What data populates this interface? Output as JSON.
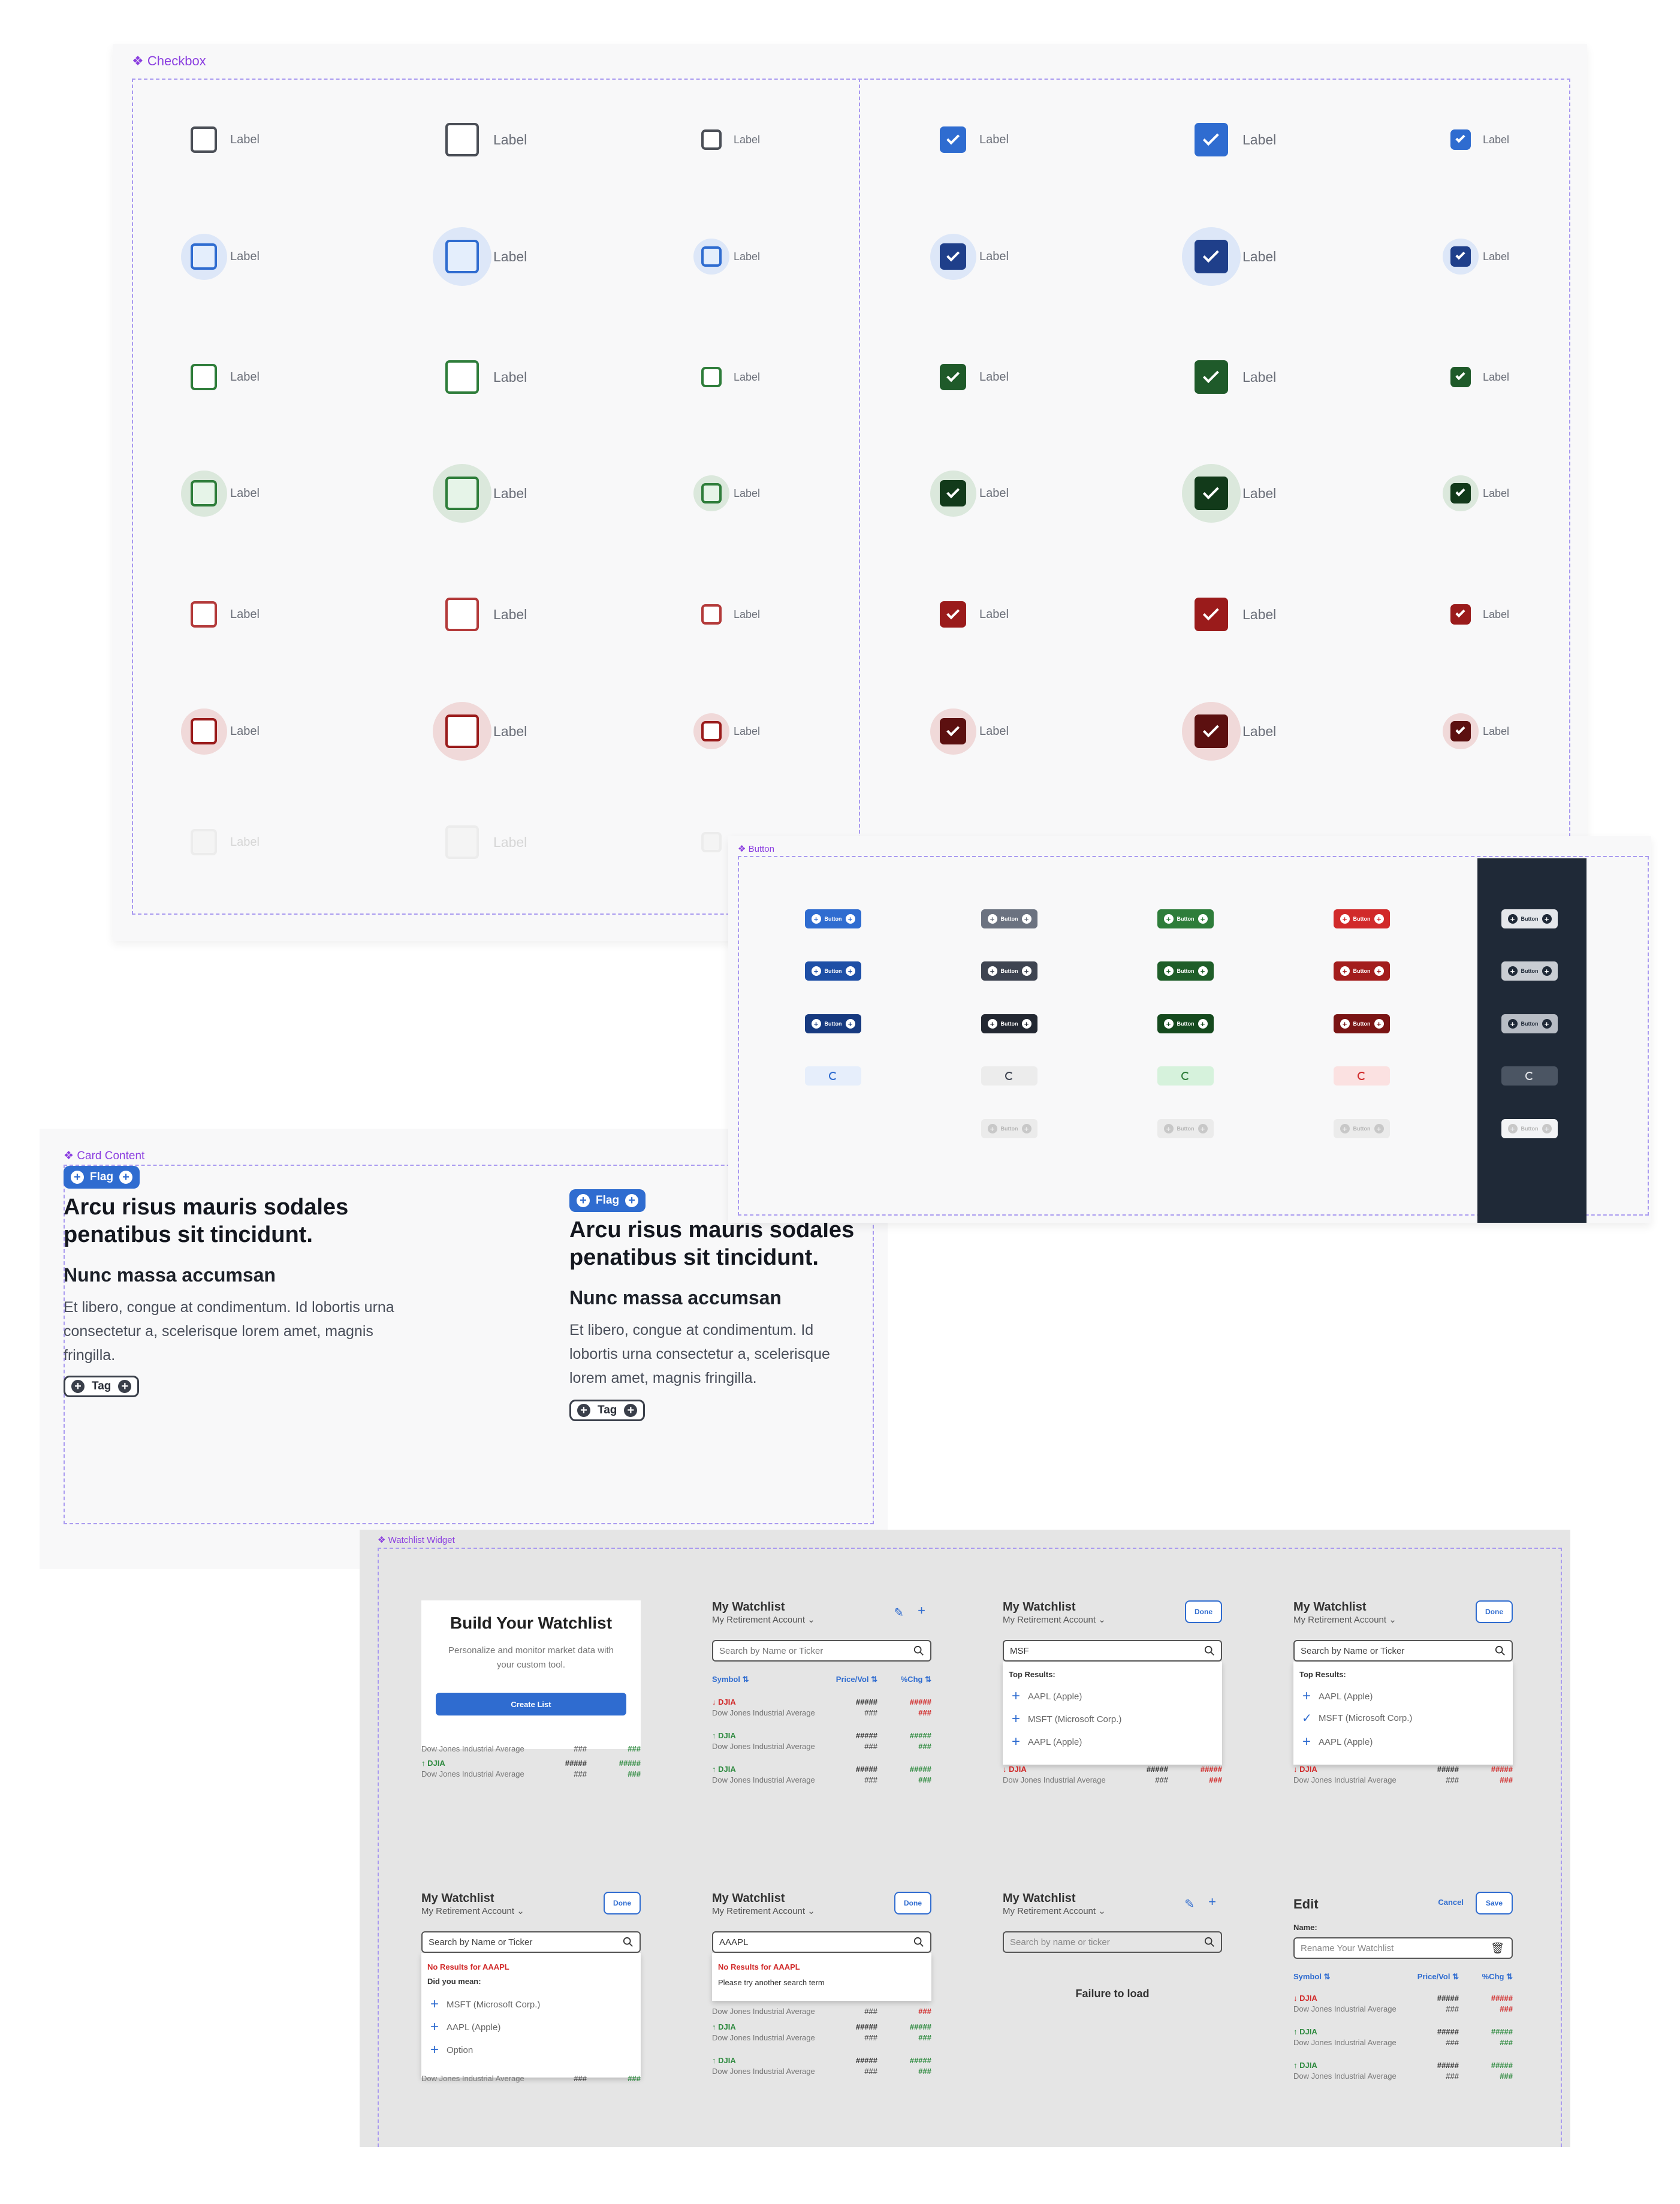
{
  "checkbox": {
    "title": "Checkbox",
    "label": "Label"
  },
  "button": {
    "title": "Button",
    "label": "Button",
    "colors": {
      "blue": "#2f6cd0",
      "gray": "#5b6270",
      "green": "#2e7d3a",
      "red": "#d12a2a",
      "dark": "#1f2937"
    }
  },
  "card": {
    "title": "Card Content",
    "flag": "Flag",
    "tag": "Tag",
    "heading": "Arcu risus mauris sodales penatibus sit tincidunt.",
    "subheading": "Nunc massa accumsan",
    "body": "Et libero, congue at condimentum. Id lobortis urna consectetur a, scelerisque lorem amet, magnis fringilla."
  },
  "watchlist": {
    "title": "Watchlist Widget",
    "build_title": "Build Your Watchlist",
    "build_desc": "Personalize and monitor market data with your custom tool.",
    "create_btn": "Create List",
    "my_watchlist": "My Watchlist",
    "account": "My Retirement Account",
    "done": "Done",
    "cancel": "Cancel",
    "save": "Save",
    "edit": "Edit",
    "name_label": "Name:",
    "rename_placeholder": "Rename Your Watchlist",
    "search_placeholder": "Search by Name or Ticker",
    "search_placeholder_lower": "Search by name or ticker",
    "search_name": "Search by Name or Ticker",
    "q_msf": "MSF",
    "q_aaapl": "AAAPL",
    "q_aaapl_short": "AAAPL",
    "top_results": "Top Results:",
    "no_results": "No Results for AAAPL",
    "did_you_mean": "Did you mean:",
    "try_another": "Please try another search term",
    "failure": "Failure to load",
    "col_symbol": "Symbol",
    "col_price": "Price/Vol",
    "col_chg": "%Chg",
    "opt_aapl": "AAPL (Apple)",
    "opt_msft": "MSFT (Microsoft Corp.)",
    "opt_option": "Option",
    "sym": "DJIA",
    "name": "Dow Jones Industrial Average",
    "v5": "#####",
    "v3": "###"
  }
}
